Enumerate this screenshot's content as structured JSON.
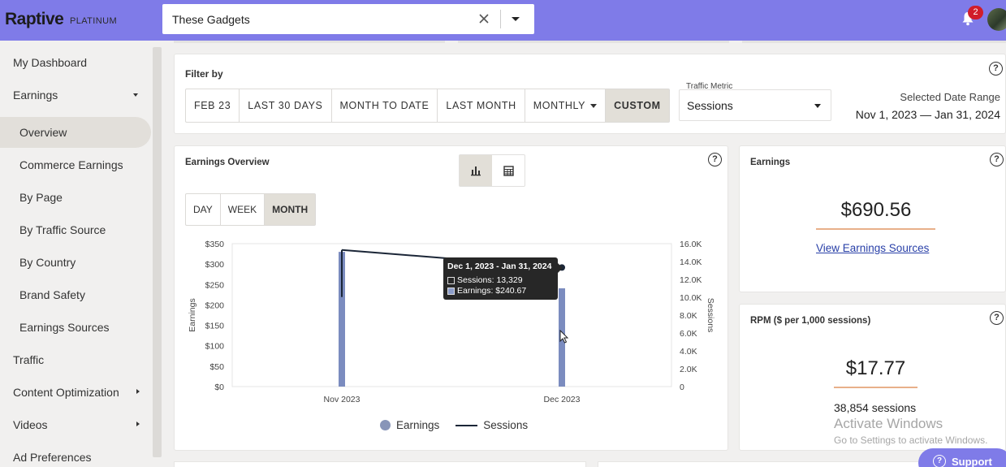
{
  "brand": {
    "name": "Raptive",
    "tier": "PLATINUM"
  },
  "site_selector": {
    "value": "These Gadgets"
  },
  "notifications": {
    "count": "2"
  },
  "sidebar": {
    "items": [
      {
        "label": "My Dashboard"
      },
      {
        "label": "Earnings"
      },
      {
        "label": "Overview"
      },
      {
        "label": "Commerce Earnings"
      },
      {
        "label": "By Page"
      },
      {
        "label": "By Traffic Source"
      },
      {
        "label": "By Country"
      },
      {
        "label": "Brand Safety"
      },
      {
        "label": "Earnings Sources"
      },
      {
        "label": "Traffic"
      },
      {
        "label": "Content Optimization"
      },
      {
        "label": "Videos"
      },
      {
        "label": "Ad Preferences"
      }
    ]
  },
  "filter": {
    "label": "Filter by",
    "buttons": [
      "FEB 23",
      "LAST 30 DAYS",
      "MONTH TO DATE",
      "LAST MONTH",
      "MONTHLY",
      "CUSTOM"
    ],
    "selected": "CUSTOM",
    "traffic_metric_label": "Traffic Metric",
    "traffic_metric_value": "Sessions",
    "date_range_label": "Selected Date Range",
    "date_range_value": "Nov 1, 2023 — Jan 31, 2024"
  },
  "earnings_overview": {
    "title": "Earnings Overview",
    "periods": [
      "DAY",
      "WEEK",
      "MONTH"
    ],
    "selected_period": "MONTH",
    "tooltip": {
      "title": "Dec 1, 2023 - Jan 31, 2024",
      "sessions": "Sessions: 13,329",
      "earnings": "Earnings: $240.67"
    },
    "legend": {
      "earnings": "Earnings",
      "sessions": "Sessions"
    }
  },
  "chart_data": {
    "type": "bar",
    "categories": [
      "Nov 2023",
      "Dec 2023"
    ],
    "series": [
      {
        "name": "Earnings",
        "type": "bar",
        "axis": "left",
        "values": [
          329.89,
          240.67
        ]
      },
      {
        "name": "Sessions",
        "type": "line",
        "axis": "right",
        "values": [
          15300,
          13329
        ]
      }
    ],
    "ylabel": "Earnings",
    "y2label": "Sessions",
    "ylim": [
      0,
      350
    ],
    "y2lim": [
      0,
      16000
    ],
    "yticks": [
      "$0",
      "$50",
      "$100",
      "$150",
      "$200",
      "$250",
      "$300",
      "$350"
    ],
    "y2ticks": [
      "0",
      "2.0K",
      "4.0K",
      "6.0K",
      "8.0K",
      "10.0K",
      "12.0K",
      "14.0K",
      "16.0K"
    ],
    "colors": {
      "bar": "#7b8cbf",
      "line": "#1b2637"
    },
    "grid": false,
    "legend": "bottom"
  },
  "earnings_card": {
    "title": "Earnings",
    "value": "$690.56",
    "link": "View Earnings Sources"
  },
  "rpm_card": {
    "title": "RPM ($ per 1,000 sessions)",
    "value": "$17.77",
    "sessions": "38,854 sessions"
  },
  "watermark": {
    "title": "Activate Windows",
    "sub": "Go to Settings to activate Windows."
  },
  "support": {
    "label": "Support"
  },
  "colors": {
    "topbar": "#7f7be8",
    "accent_underline": "#e8b08a",
    "link": "#2940a8",
    "badge": "#d11d2b"
  }
}
